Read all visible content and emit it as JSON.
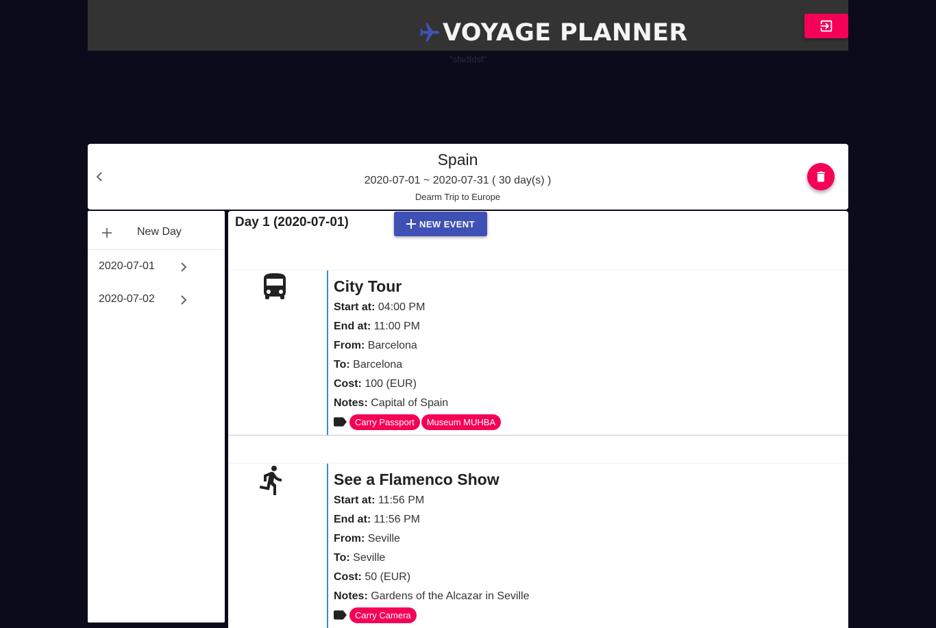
{
  "header": {
    "app_title": "VOYAGE PLANNER",
    "subtitle": "\"sfsdfdsf\"",
    "brand_icon": "airplane-icon",
    "logout_icon": "exit-to-app-icon",
    "accent_color": "#f50057",
    "primary_color": "#3f51b5"
  },
  "trip": {
    "name": "Spain",
    "dates": "2020-07-01 ~ 2020-07-31 ( 30 day(s) )",
    "description": "Dearm Trip to Europe"
  },
  "sidebar": {
    "new_day_label": "New Day",
    "days": [
      {
        "label": "2020-07-01"
      },
      {
        "label": "2020-07-02"
      }
    ]
  },
  "main": {
    "day_title": "Day 1 (2020-07-01)",
    "new_event_label": "NEW EVENT",
    "events": [
      {
        "icon": "bus-icon",
        "title": "City Tour",
        "start_label": "Start at:",
        "start": "04:00 PM",
        "end_label": "End at:",
        "end": "11:00 PM",
        "from_label": "From:",
        "from": "Barcelona",
        "to_label": "To:",
        "to": "Barcelona",
        "cost_label": "Cost:",
        "cost": "100 (EUR)",
        "notes_label": "Notes:",
        "notes": "Capital of Spain",
        "tags": [
          "Carry Passport",
          "Museum MUHBA"
        ]
      },
      {
        "icon": "running-person-icon",
        "title": "See a Flamenco Show",
        "start_label": "Start at:",
        "start": "11:56 PM",
        "end_label": "End at:",
        "end": "11:56 PM",
        "from_label": "From:",
        "from": "Seville",
        "to_label": "To:",
        "to": "Seville",
        "cost_label": "Cost:",
        "cost": "50 (EUR)",
        "notes_label": "Notes:",
        "notes": "Gardens of the Alcazar in Seville",
        "tags": [
          "Carry Camera"
        ]
      }
    ]
  }
}
